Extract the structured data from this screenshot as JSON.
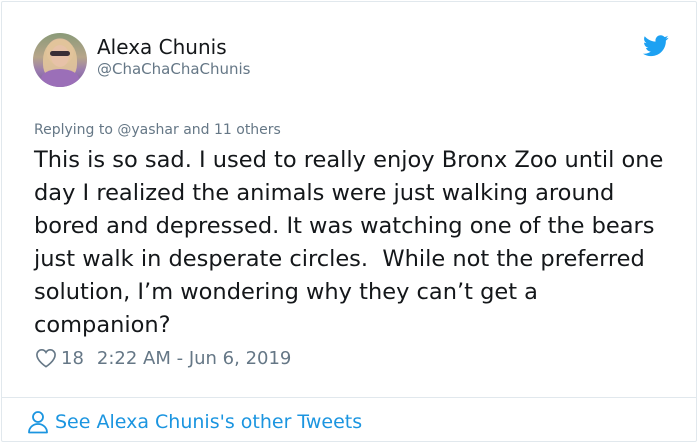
{
  "user": {
    "name": "Alexa Chunis",
    "handle": "@ChaChaChaChunis"
  },
  "tweet": {
    "replying_to": "Replying to @yashar and 11 others",
    "text": "This is so sad. I used to really enjoy Bronx Zoo until one day I realized the animals were just walking around bored and depressed. It was watching one of the bears just walk in desperate circles.  While not the preferred solution, I’m wondering why they can’t get a companion?",
    "likes": "18",
    "timestamp": "2:22 AM - Jun 6, 2019"
  },
  "footer": {
    "link_label": "See Alexa Chunis's other Tweets"
  },
  "icons": {
    "brand": "twitter-bird-icon",
    "like": "heart-icon",
    "profile": "person-icon"
  },
  "colors": {
    "link": "#1b95e0",
    "secondary_text": "#657786",
    "primary_text": "#14171a",
    "twitter_blue": "#1da1f2",
    "border": "#e1e8ed"
  }
}
